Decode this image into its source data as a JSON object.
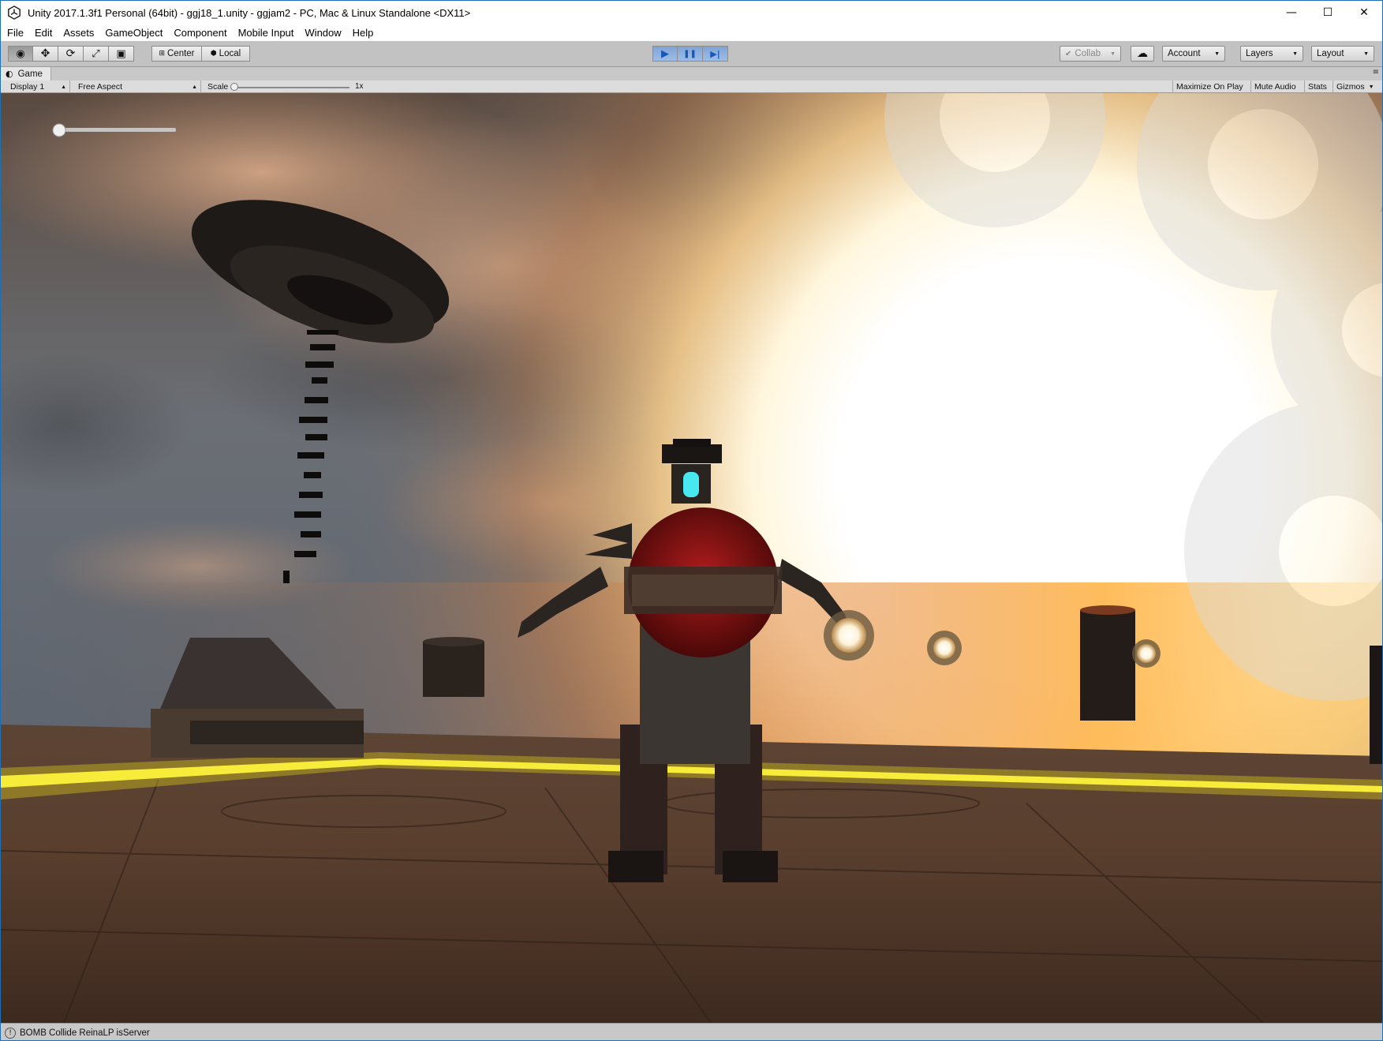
{
  "window": {
    "title": "Unity 2017.1.3f1 Personal (64bit) - ggj18_1.unity - ggjam2 - PC, Mac & Linux Standalone <DX11>",
    "icon": "unity-logo-icon",
    "controls": {
      "minimize": "—",
      "maximize": "☐",
      "close": "✕"
    }
  },
  "menu": [
    "File",
    "Edit",
    "Assets",
    "GameObject",
    "Component",
    "Mobile Input",
    "Window",
    "Help"
  ],
  "toolbar": {
    "tools": [
      {
        "name": "view-tool",
        "glyph": "◉",
        "active": true
      },
      {
        "name": "move-tool",
        "glyph": "✥",
        "active": false
      },
      {
        "name": "rotate-tool",
        "glyph": "⟳",
        "active": false
      },
      {
        "name": "scale-tool",
        "glyph": "⤢",
        "active": false
      },
      {
        "name": "rect-tool",
        "glyph": "▣",
        "active": false
      }
    ],
    "pivot_center": "Center",
    "pivot_local": "Local",
    "play": {
      "play_glyph": "▶",
      "pause_glyph": "❚❚",
      "step_glyph": "▶|"
    },
    "collab": "Collab",
    "cloud_glyph": "☁",
    "account": "Account",
    "layers": "Layers",
    "layout": "Layout"
  },
  "game_tab": {
    "tab_label": "Game",
    "tab_icon": "pacman-icon",
    "display": "Display 1",
    "aspect": "Free Aspect",
    "scale_label": "Scale",
    "scale_value": "1x",
    "maximize_on_play": "Maximize On Play",
    "mute_audio": "Mute Audio",
    "stats": "Stats",
    "gizmos": "Gizmos"
  },
  "game_view": {
    "hud_slider_value": 0.0
  },
  "status": {
    "icon": "info-icon",
    "message": "BOMB Collide ReinaLP isServer"
  },
  "colors": {
    "toolbar_bg": "#c2c2c2",
    "play_active": "#7fa4d6",
    "glow_yellow": "#f2e11a",
    "sun_white": "#ffffff",
    "sky_gray": "#6f7478"
  }
}
